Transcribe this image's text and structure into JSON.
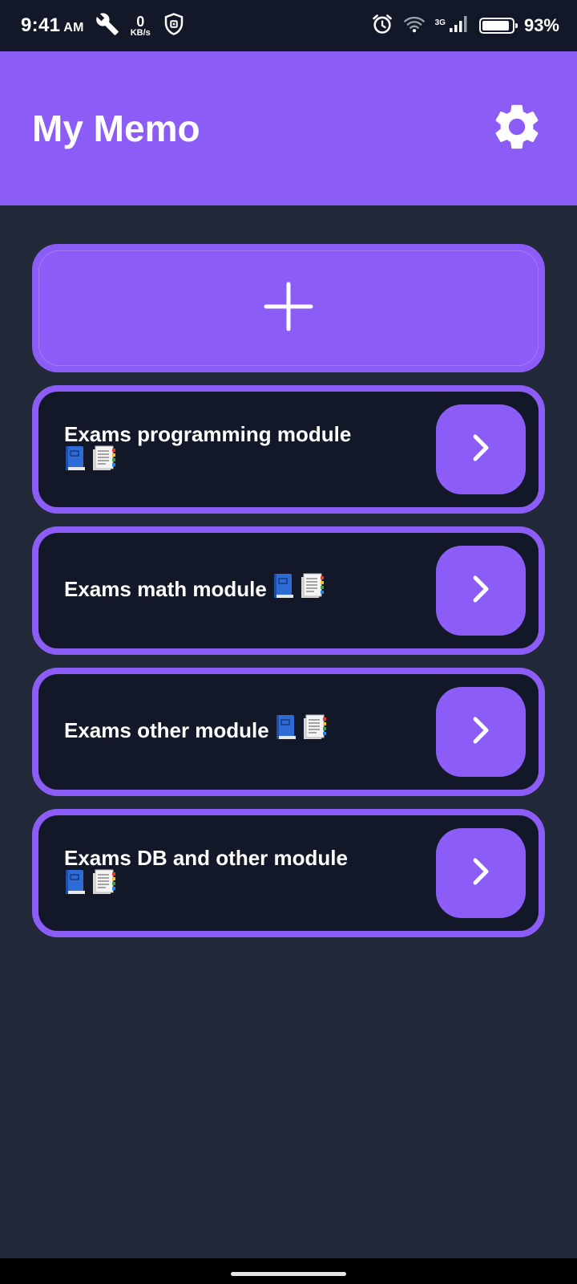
{
  "status_bar": {
    "time": "9:41",
    "ampm": "AM",
    "speed_value": "0",
    "speed_unit": "KB/s",
    "network_type": "3G",
    "battery_percent": "93%",
    "battery_level": 0.93,
    "icons": [
      "wrench-icon",
      "shield-icon",
      "alarm-icon",
      "wifi-icon",
      "signal-icon",
      "battery-icon"
    ]
  },
  "header": {
    "title": "My Memo",
    "settings_icon": "gear-icon"
  },
  "add_button": {
    "icon": "plus-icon"
  },
  "modules": [
    {
      "title": "Exams programming module",
      "icons": [
        "blue-book-icon",
        "notepad-icon"
      ]
    },
    {
      "title": "Exams math module",
      "icons": [
        "blue-book-icon",
        "notepad-icon"
      ]
    },
    {
      "title": "Exams other module",
      "icons": [
        "blue-book-icon",
        "notepad-icon"
      ]
    },
    {
      "title": "Exams DB and other module",
      "icons": [
        "blue-book-icon",
        "notepad-icon"
      ]
    }
  ],
  "colors": {
    "accent": "#8b5cf6",
    "background": "#222a39",
    "card_background": "#131829",
    "status_bar": "#121827"
  }
}
